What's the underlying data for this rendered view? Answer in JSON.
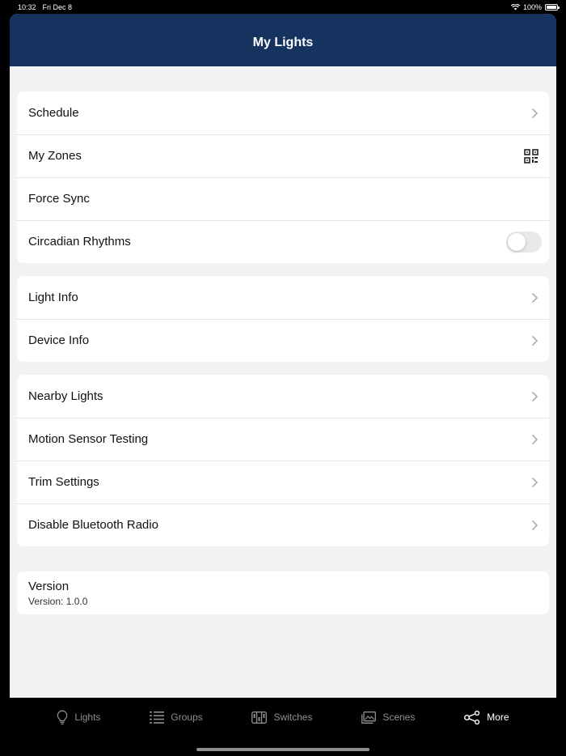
{
  "status_bar": {
    "time": "10:32",
    "date": "Fri Dec 8",
    "battery": "100%",
    "wifi_icon": "wifi-icon",
    "battery_icon": "battery-icon"
  },
  "nav": {
    "title": "My Lights"
  },
  "groups": [
    {
      "rows": [
        {
          "label": "Schedule",
          "accessory": "chevron"
        },
        {
          "label": "My Zones",
          "accessory": "qr-code"
        },
        {
          "label": "Force Sync",
          "accessory": "none"
        },
        {
          "label": "Circadian Rhythms",
          "accessory": "toggle",
          "toggle_on": false
        }
      ]
    },
    {
      "rows": [
        {
          "label": "Light Info",
          "accessory": "chevron"
        },
        {
          "label": "Device Info",
          "accessory": "chevron"
        }
      ]
    },
    {
      "rows": [
        {
          "label": "Nearby Lights",
          "accessory": "chevron"
        },
        {
          "label": "Motion Sensor Testing",
          "accessory": "chevron"
        },
        {
          "label": "Trim Settings",
          "accessory": "chevron"
        },
        {
          "label": "Disable Bluetooth Radio",
          "accessory": "chevron"
        }
      ]
    }
  ],
  "version": {
    "title": "Version",
    "value": "Version: 1.0.0"
  },
  "tabs": [
    {
      "label": "Lights",
      "icon": "lightbulb-icon",
      "active": false
    },
    {
      "label": "Groups",
      "icon": "groups-grid-icon",
      "active": false
    },
    {
      "label": "Switches",
      "icon": "switches-icon",
      "active": false
    },
    {
      "label": "Scenes",
      "icon": "scenes-icon",
      "active": false
    },
    {
      "label": "More",
      "icon": "share-nodes-icon",
      "active": true
    }
  ],
  "colors": {
    "nav_background": "#16325f",
    "page_background": "#f2f2f2",
    "tab_active": "#ffffff",
    "tab_inactive": "#8e8e93"
  }
}
